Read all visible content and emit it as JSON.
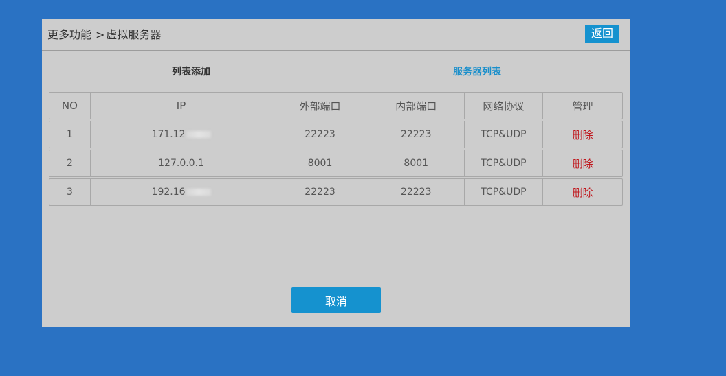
{
  "header": {
    "breadcrumb_root": "更多功能",
    "breadcrumb_sep": ">",
    "breadcrumb_current": "虚拟服务器",
    "back_label": "返回"
  },
  "tabs": {
    "add_label": "列表添加",
    "list_label": "服务器列表"
  },
  "table": {
    "columns": [
      "NO",
      "IP",
      "外部端口",
      "内部端口",
      "网络协议",
      "管理"
    ],
    "rows": [
      {
        "no": "1",
        "ip": "171.12",
        "ext": "22223",
        "int": "22223",
        "proto": "TCP&UDP",
        "action": "删除"
      },
      {
        "no": "2",
        "ip": "127.0.0.1",
        "ext": "8001",
        "int": "8001",
        "proto": "TCP&UDP",
        "action": "删除"
      },
      {
        "no": "3",
        "ip": "192.16",
        "ext": "22223",
        "int": "22223",
        "proto": "TCP&UDP",
        "action": "删除"
      }
    ]
  },
  "footer": {
    "cancel_label": "取消"
  },
  "colors": {
    "background": "#2a72c3",
    "panel": "#cdcdcd",
    "accent": "#1592cf",
    "delete": "#c0161c"
  }
}
